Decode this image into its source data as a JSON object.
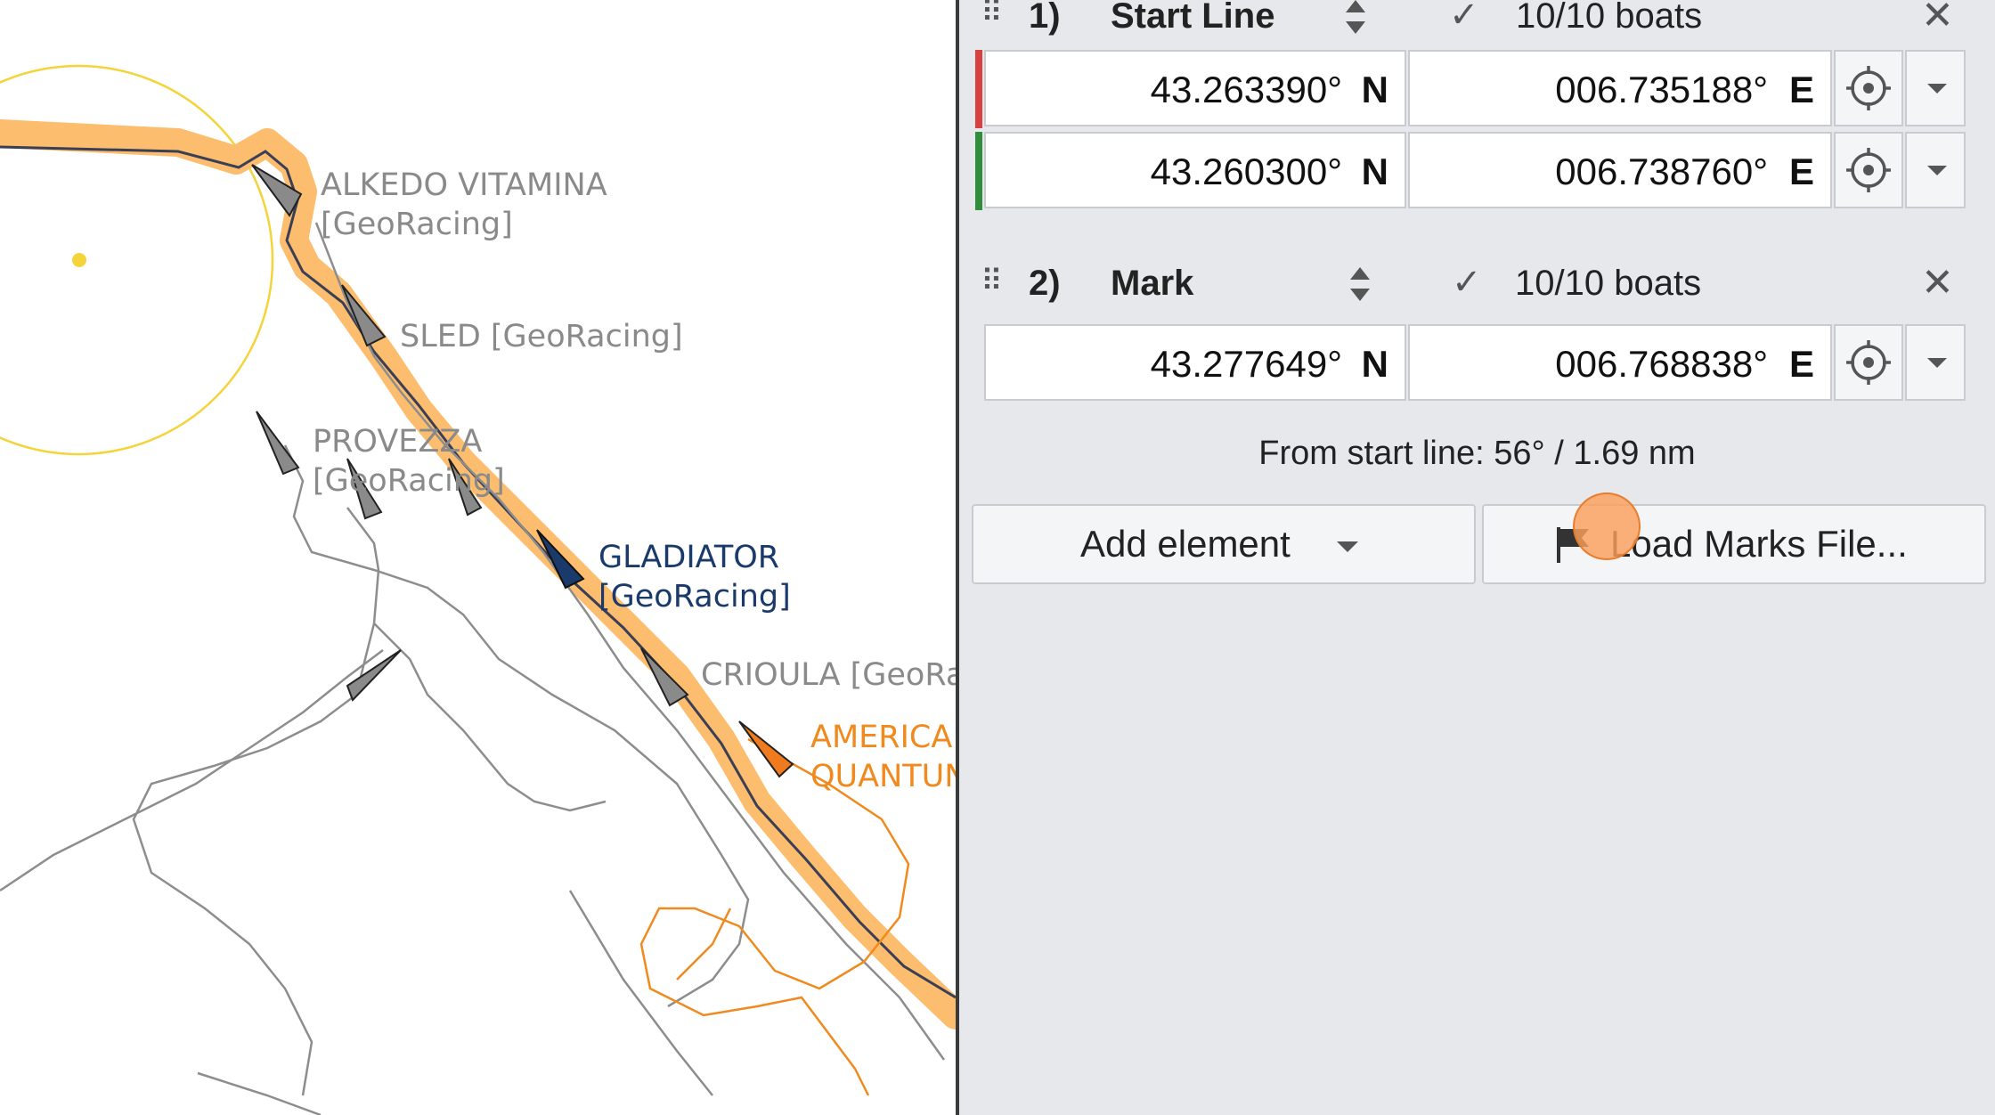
{
  "map": {
    "circle_color": "#f5d33a",
    "track_highlight_color": "#fdbd6e",
    "boats": [
      {
        "name_line1": "ALKEDO VITAMINA",
        "name_line2": "[GeoRacing]",
        "color": "gray"
      },
      {
        "name_line1": "SLED [GeoRacing]",
        "name_line2": "",
        "color": "gray"
      },
      {
        "name_line1": "PROVEZZA",
        "name_line2": "[GeoRacing]",
        "color": "gray"
      },
      {
        "name_line1": "GLADIATOR",
        "name_line2": "[GeoRacing]",
        "color": "navy"
      },
      {
        "name_line1": "CRIOULA [GeoRa",
        "name_line2": "",
        "color": "gray"
      },
      {
        "name_line1": "AMERICA",
        "name_line2": "QUANTUN",
        "color": "orange"
      }
    ]
  },
  "panel": {
    "elements": [
      {
        "index": "1)",
        "title": "Start Line",
        "boats": "10/10 boats",
        "positions": [
          {
            "lat": "43.263390°",
            "lat_dir": "N",
            "lon": "006.735188°",
            "lon_dir": "E",
            "marker_color": "#d94040"
          },
          {
            "lat": "43.260300°",
            "lat_dir": "N",
            "lon": "006.738760°",
            "lon_dir": "E",
            "marker_color": "#2f8f3a"
          }
        ]
      },
      {
        "index": "2)",
        "title": "Mark",
        "boats": "10/10 boats",
        "positions": [
          {
            "lat": "43.277649°",
            "lat_dir": "N",
            "lon": "006.768838°",
            "lon_dir": "E"
          }
        ]
      }
    ],
    "from_start": "From start line: 56° / 1.69 nm",
    "add_element_label": "Add element",
    "load_marks_label": "Load Marks File..."
  },
  "icons": {
    "drag": "drag-handle-icon",
    "sort": "sort-icon",
    "check": "check-icon",
    "close": "close-icon",
    "target": "crosshair-icon",
    "caret": "caret-down-icon",
    "flag": "flag-icon"
  }
}
